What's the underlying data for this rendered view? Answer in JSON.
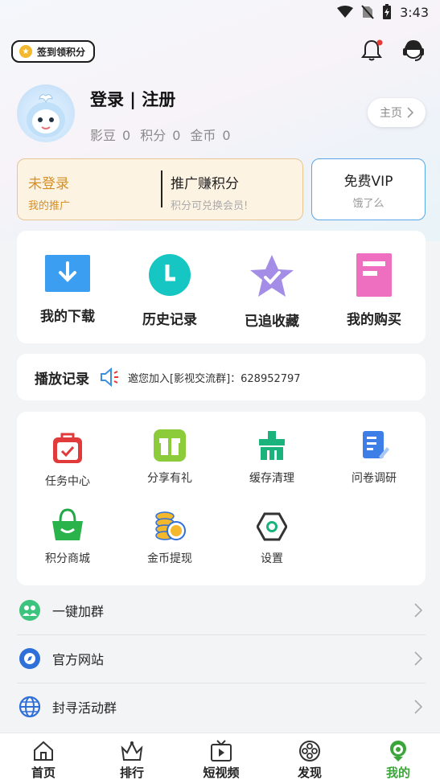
{
  "status_bar": {
    "time": "3:43"
  },
  "header": {
    "checkin_label": "签到领积分",
    "login_title": "登录 | 注册",
    "stats": [
      {
        "label": "影豆",
        "value": "0"
      },
      {
        "label": "积分",
        "value": "0"
      },
      {
        "label": "金币",
        "value": "0"
      }
    ],
    "homepage_label": "主页"
  },
  "promo": {
    "status": "未登录",
    "my_promo": "我的推广",
    "earn_title": "推广赚积分",
    "earn_sub": "积分可兑换会员!",
    "vip_title": "免费VIP",
    "vip_sub": "饿了么"
  },
  "quick_actions": [
    {
      "label": "我的下载"
    },
    {
      "label": "历史记录"
    },
    {
      "label": "已追收藏"
    },
    {
      "label": "我的购买"
    }
  ],
  "history": {
    "label": "播放记录",
    "notice": "邀您加入[影视交流群]：628952797"
  },
  "tools": [
    {
      "label": "任务中心"
    },
    {
      "label": "分享有礼"
    },
    {
      "label": "缓存清理"
    },
    {
      "label": "问卷调研"
    },
    {
      "label": "积分商城"
    },
    {
      "label": "金币提现"
    },
    {
      "label": "设置"
    }
  ],
  "list": [
    {
      "label": "一键加群"
    },
    {
      "label": "官方网站"
    },
    {
      "label": "封寻活动群"
    }
  ],
  "tabs": [
    {
      "label": "首页"
    },
    {
      "label": "排行"
    },
    {
      "label": "短视频"
    },
    {
      "label": "发现"
    },
    {
      "label": "我的"
    }
  ],
  "colors": {
    "accent_green": "#3aa539",
    "promo_orange": "#d58f24",
    "vip_border": "#5aa6e6"
  }
}
